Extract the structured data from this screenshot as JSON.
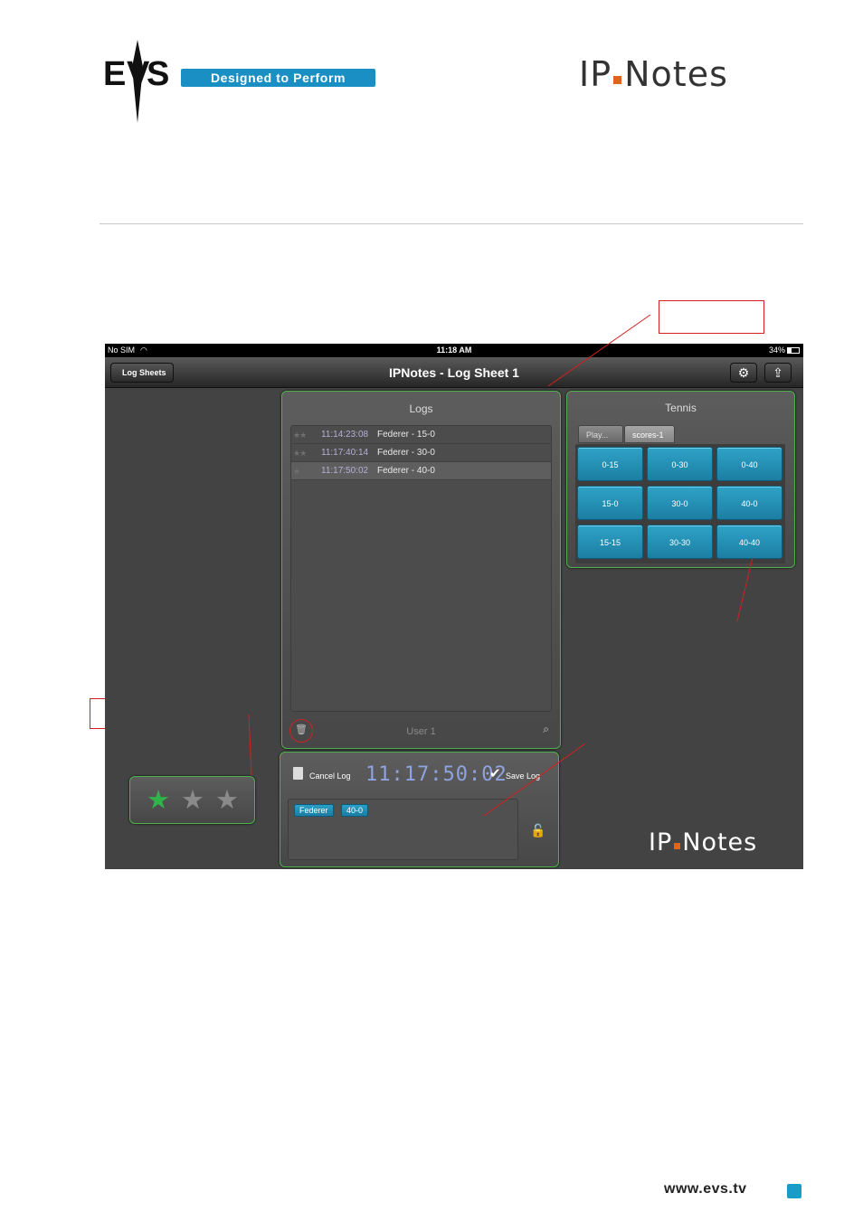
{
  "header": {
    "tagline": "Designed to Perform",
    "product_logo_left": "IP",
    "product_logo_right": "Notes"
  },
  "screenshot": {
    "status_bar": {
      "carrier": "No SIM",
      "time": "11:18 AM",
      "battery": "34%"
    },
    "nav": {
      "back_label": "Log Sheets",
      "title": "IPNotes - Log Sheet 1",
      "settings_icon": "gear-icon",
      "share_icon": "share-icon"
    },
    "logs_panel": {
      "title": "Logs",
      "rows": [
        {
          "stars": "★★",
          "time": "11:14:23:08",
          "desc": "Federer - 15-0"
        },
        {
          "stars": "★★",
          "time": "11:17:40:14",
          "desc": "Federer - 30-0"
        },
        {
          "stars": "★",
          "time": "11:17:50:02",
          "desc": "Federer - 40-0"
        }
      ],
      "user": "User 1"
    },
    "tennis_panel": {
      "title": "Tennis",
      "tabs": [
        "Play...",
        "scores-1"
      ],
      "scores": [
        "0-15",
        "0-30",
        "0-40",
        "15-0",
        "30-0",
        "40-0",
        "15-15",
        "30-30",
        "40-40"
      ]
    },
    "rating": {
      "value": 1,
      "max": 3,
      "active_color": "#2fb34a",
      "inactive_color": "#8a8a8a"
    },
    "current_log": {
      "cancel_label": "Cancel Log",
      "timecode": "11:17:50:02",
      "save_label": "Save Log",
      "tags": [
        "Federer",
        "40-0"
      ]
    },
    "footer_logo_left": "IP",
    "footer_logo_right": "Notes"
  },
  "footer": {
    "url": "www.evs.tv"
  },
  "colors": {
    "accent": "#1a8fc3",
    "panel_border": "#4fb04f",
    "button_blue": "#2ea3c7",
    "callout": "#d32020"
  }
}
